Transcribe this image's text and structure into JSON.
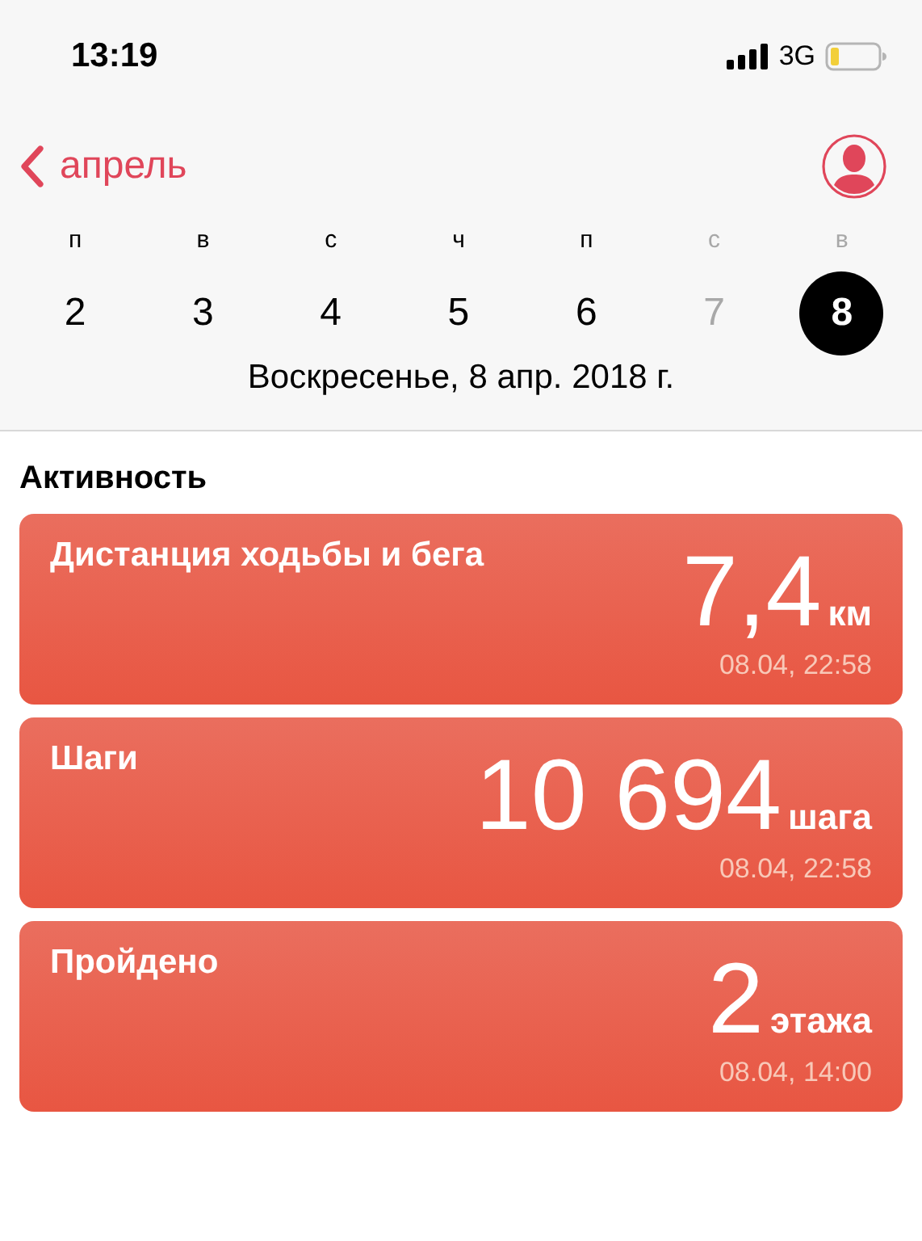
{
  "status_bar": {
    "time": "13:19",
    "network": "3G"
  },
  "nav": {
    "back_label": "апрель"
  },
  "week": [
    {
      "letter": "п",
      "number": "2",
      "selected": false,
      "muted": false
    },
    {
      "letter": "в",
      "number": "3",
      "selected": false,
      "muted": false
    },
    {
      "letter": "с",
      "number": "4",
      "selected": false,
      "muted": false
    },
    {
      "letter": "ч",
      "number": "5",
      "selected": false,
      "muted": false
    },
    {
      "letter": "п",
      "number": "6",
      "selected": false,
      "muted": false
    },
    {
      "letter": "с",
      "number": "7",
      "selected": false,
      "muted": true
    },
    {
      "letter": "в",
      "number": "8",
      "selected": true,
      "muted": true
    }
  ],
  "date_label": "Воскресенье, 8 апр. 2018 г.",
  "section_title": "Активность",
  "cards": [
    {
      "title": "Дистанция ходьбы и бега",
      "value": "7,4",
      "unit": "км",
      "time": "08.04, 22:58"
    },
    {
      "title": "Шаги",
      "value": "10 694",
      "unit": "шага",
      "time": "08.04, 22:58"
    },
    {
      "title": "Пройдено",
      "value": "2",
      "unit": "этажа",
      "time": "08.04, 14:00"
    }
  ]
}
